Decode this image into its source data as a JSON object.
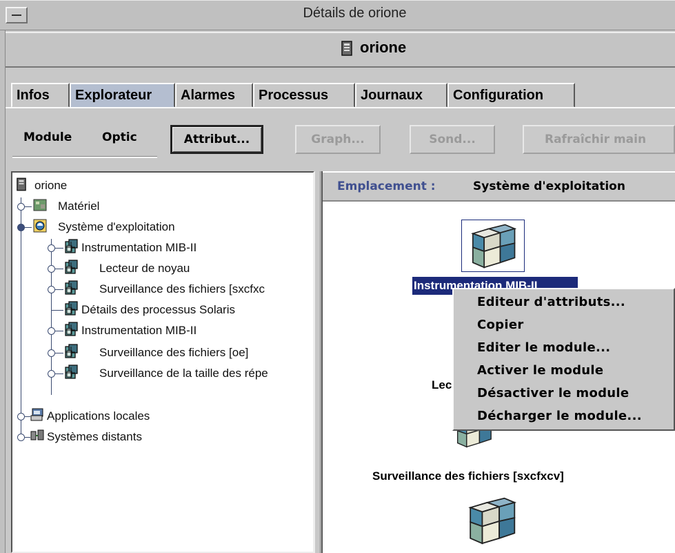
{
  "window": {
    "title": "Détails de orione"
  },
  "header": {
    "host": "orione"
  },
  "tabs": [
    {
      "label": "Infos",
      "active": false
    },
    {
      "label": "Explorateur",
      "active": true
    },
    {
      "label": "Alarmes",
      "active": false
    },
    {
      "label": "Processus",
      "active": false
    },
    {
      "label": "Journaux",
      "active": false
    },
    {
      "label": "Configuration",
      "active": false
    }
  ],
  "toolbar": {
    "menus": [
      "Module",
      "Optic"
    ],
    "buttons": [
      {
        "label": "Attribut...",
        "enabled": true
      },
      {
        "label": "Graph...",
        "enabled": false
      },
      {
        "label": "Sond...",
        "enabled": false
      },
      {
        "label": "Rafraîchir main",
        "enabled": false
      }
    ]
  },
  "tree": {
    "root": "orione",
    "items": [
      "Matériel",
      "Système d'exploitation",
      "Instrumentation MIB-II",
      "Lecteur de noyau",
      "Surveillance des fichiers [sxcfxc",
      "Détails des processus Solaris",
      "Instrumentation MIB-II",
      "Surveillance des fichiers [oe]",
      "Surveillance de la taille des répe",
      "Applications locales",
      "Systèmes distants"
    ]
  },
  "location": {
    "label": "Emplacement :",
    "value": "Système d'exploitation"
  },
  "canvas": {
    "selected_module": "Instrumentation MIB-II",
    "partial_label": "Lec",
    "module_label": "Surveillance des fichiers [sxcfxcv]"
  },
  "context_menu": {
    "items": [
      "Editeur d'attributs...",
      "Copier",
      "Editer le module...",
      "Activer le module",
      "Désactiver le module",
      "Décharger le module..."
    ]
  },
  "colors": {
    "selection": "#1c2a7a",
    "active_tab": "#b4bed0",
    "location_label": "#405090",
    "chrome": "#c8c8c8"
  }
}
